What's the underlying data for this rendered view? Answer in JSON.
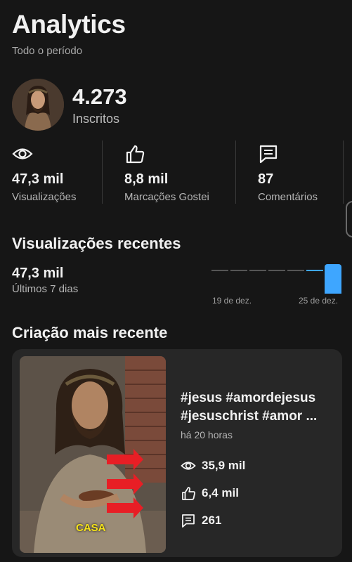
{
  "header": {
    "title": "Analytics",
    "period": "Todo o período"
  },
  "channel": {
    "subscribers_value": "4.273",
    "subscribers_label": "Inscritos"
  },
  "stats": [
    {
      "icon": "eye-icon",
      "value": "47,3 mil",
      "label": "Visualizações"
    },
    {
      "icon": "thumbs-up-icon",
      "value": "8,8 mil",
      "label": "Marcações Gostei"
    },
    {
      "icon": "comment-icon",
      "value": "87",
      "label": "Comentários"
    }
  ],
  "recent_views": {
    "title": "Visualizações recentes",
    "value": "47,3 mil",
    "period": "Últimos 7 dias",
    "chart_ticks": [
      "19 de dez.",
      "25 de dez."
    ],
    "accent_color": "#3ea6ff"
  },
  "latest_creation": {
    "title": "Criação mais recente",
    "post_title": "#jesus #amordejesus #jesuschrist #amor ...",
    "time": "há 20 horas",
    "thumbnail_caption": "CASA",
    "views": "35,9 mil",
    "likes": "6,4 mil",
    "comments": "261"
  }
}
